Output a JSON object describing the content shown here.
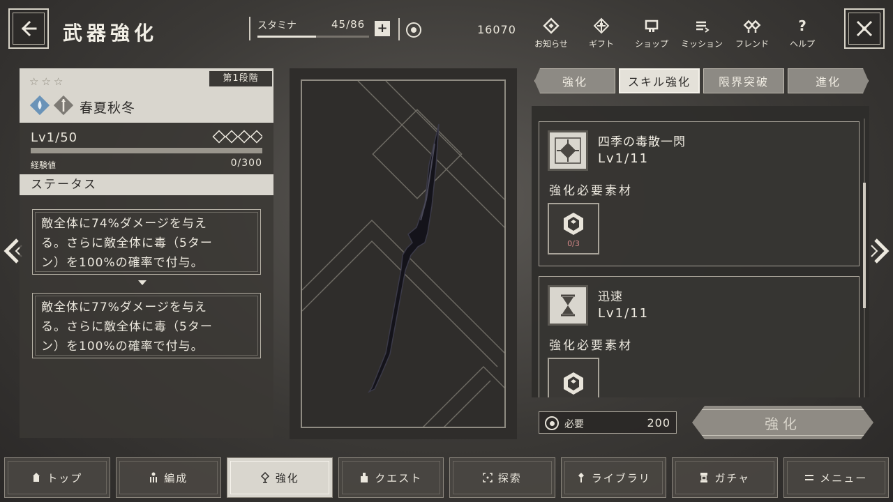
{
  "header": {
    "title": "武器強化",
    "stamina": {
      "label": "スタミナ",
      "value": "45/86",
      "fraction": 0.523,
      "plus": "+"
    },
    "currency": "16070"
  },
  "top_menu": [
    {
      "label": "お知らせ",
      "icon": "notice-icon"
    },
    {
      "label": "ギフト",
      "icon": "gift-icon"
    },
    {
      "label": "ショップ",
      "icon": "shop-icon"
    },
    {
      "label": "ミッション",
      "icon": "mission-icon"
    },
    {
      "label": "フレンド",
      "icon": "friend-icon"
    },
    {
      "label": "ヘルプ",
      "icon": "help-icon"
    }
  ],
  "weapon": {
    "stars": [
      "☆",
      "☆",
      "☆"
    ],
    "stage": "第1段階",
    "name": "春夏秋冬",
    "level": "Lv1/50",
    "exp_label": "経験値",
    "exp_value": "0/300",
    "exp_fraction": 0
  },
  "status": {
    "heading": "ステータス",
    "current": [
      "敵全体に74%ダメージを与え",
      "る。さらに敵全体に毒（5ター",
      "ン）を100%の確率で付与。"
    ],
    "next": [
      "敵全体に77%ダメージを与え",
      "る。さらに敵全体に毒（5ター",
      "ン）を100%の確率で付与。"
    ]
  },
  "tabs": [
    {
      "label": "強化",
      "active": false
    },
    {
      "label": "スキル強化",
      "active": true
    },
    {
      "label": "限界突破",
      "active": false
    },
    {
      "label": "進化",
      "active": false
    }
  ],
  "skills": [
    {
      "name": "四季の毒散一閃",
      "level": "Lv1/11",
      "material_label": "強化必要素材",
      "material_count": "0/3",
      "icon": "burst-skill-icon"
    },
    {
      "name": "迅速",
      "level": "Lv1/11",
      "material_label": "強化必要素材",
      "material_count": "",
      "icon": "hourglass-skill-icon"
    }
  ],
  "cost": {
    "label": "必要",
    "value": "200"
  },
  "enhance_button": "強化",
  "bottom_nav": [
    {
      "label": "トップ",
      "active": false
    },
    {
      "label": "編成",
      "active": false
    },
    {
      "label": "強化",
      "active": true
    },
    {
      "label": "クエスト",
      "active": false
    },
    {
      "label": "探索",
      "active": false
    },
    {
      "label": "ライブラリ",
      "active": false
    },
    {
      "label": "ガチャ",
      "active": false
    },
    {
      "label": "メニュー",
      "active": false
    }
  ]
}
